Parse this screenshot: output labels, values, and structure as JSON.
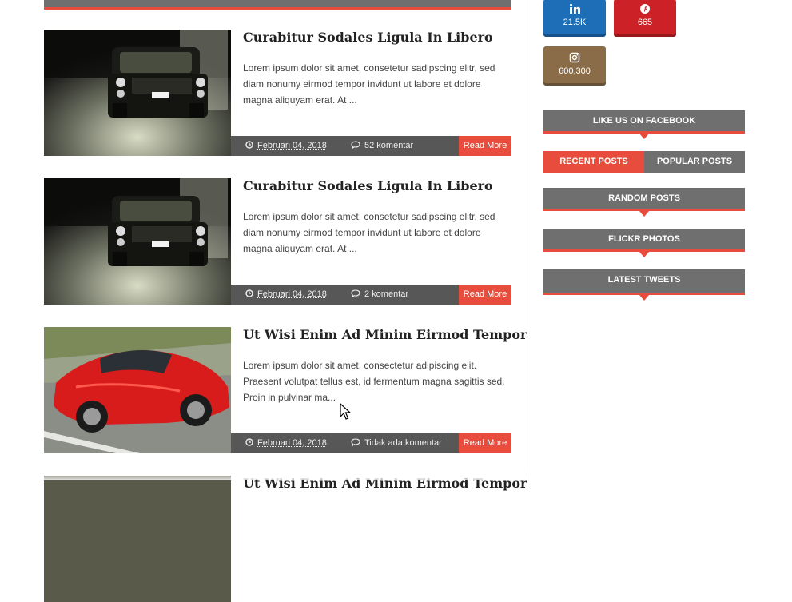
{
  "posts": [
    {
      "title": "Curabitur Sodales Ligula In Libero",
      "excerpt": "Lorem ipsum dolor sit amet, consetetur sadipscing elitr, sed diam nonumy eirmod tempor invidunt ut labore et dolore magna aliquyam erat. At ...",
      "date": "Februari 04, 2018",
      "comments": "52 komentar",
      "read_more": "Read More"
    },
    {
      "title": "Curabitur Sodales Ligula In Libero",
      "excerpt": "Lorem ipsum dolor sit amet, consetetur sadipscing elitr, sed diam nonumy eirmod tempor invidunt ut labore et dolore magna aliquyam erat. At ...",
      "date": "Februari 04, 2018",
      "comments": "2 komentar",
      "read_more": "Read More"
    },
    {
      "title": "Ut Wisi Enim Ad Minim Eirmod Tempor",
      "excerpt": "Lorem ipsum dolor sit amet, consectetur adipiscing elit. Praesent volutpat tellus est, id fermentum magna sagittis sed. Proin in pulvinar ma...",
      "date": "Februari 04, 2018",
      "comments": "Tidak ada komentar",
      "read_more": "Read More"
    },
    {
      "title": "Ut Wisi Enim Ad Minim Eirmod Tempor"
    }
  ],
  "social": {
    "linkedin": {
      "icon": "linkedin-icon",
      "count": "21.5K",
      "color": "#1e6db7"
    },
    "pinterest": {
      "icon": "pinterest-icon",
      "count": "665",
      "color": "#cc2127"
    },
    "instagram": {
      "icon": "instagram-icon",
      "count": "600,300",
      "color": "#8a6d48"
    }
  },
  "widgets": {
    "facebook": "LIKE US ON FACEBOOK",
    "tabs": {
      "recent": "RECENT POSTS",
      "popular": "POPULAR POSTS"
    },
    "random": "RANDOM POSTS",
    "flickr": "FLICKR PHOTOS",
    "tweets": "LATEST TWEETS"
  },
  "colors": {
    "accent": "#e74c3c",
    "header_gray": "#6f6f6f",
    "meta_bar": "#575757"
  }
}
